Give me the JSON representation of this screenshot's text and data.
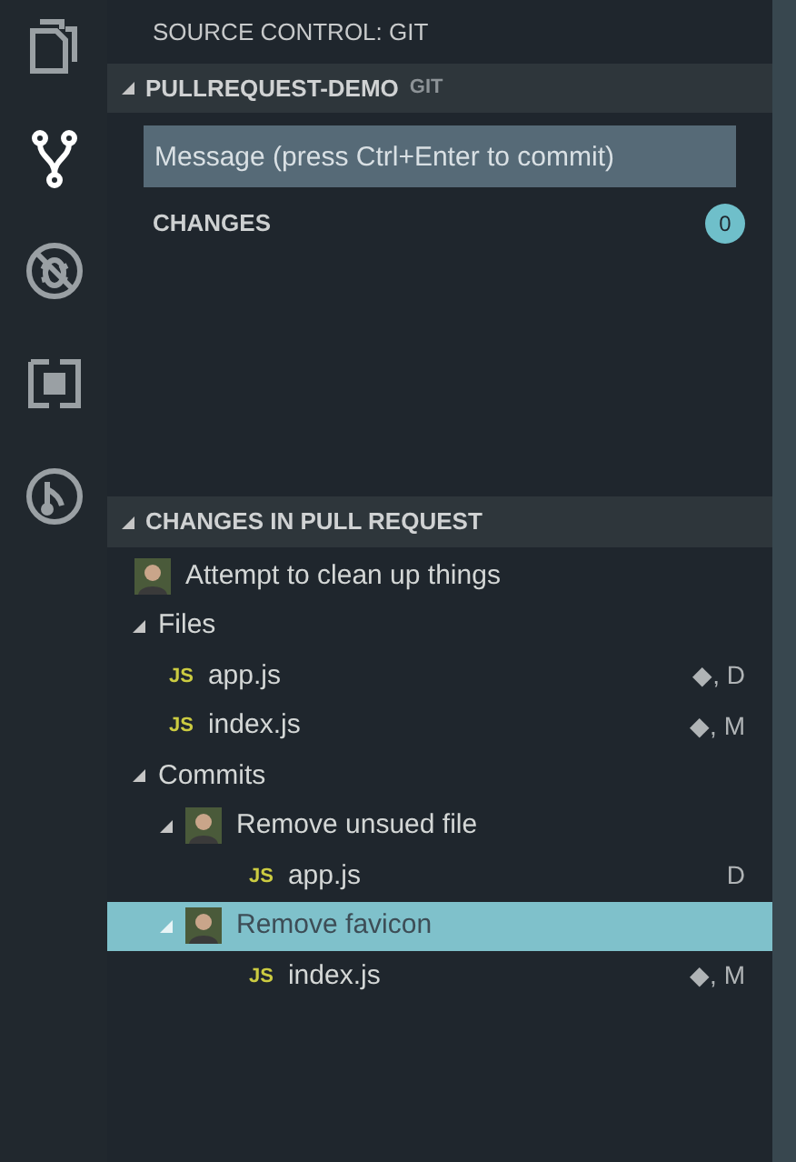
{
  "activity_bar": [
    {
      "kind": "files",
      "selected": false
    },
    {
      "kind": "scm",
      "selected": true
    },
    {
      "kind": "debug",
      "selected": false
    },
    {
      "kind": "extensions",
      "selected": false
    },
    {
      "kind": "pullrequest",
      "selected": false
    }
  ],
  "panel_title": "SOURCE CONTROL: GIT",
  "repo": {
    "name": "PULLREQUEST-DEMO",
    "provider": "GIT",
    "expanded": true
  },
  "message": {
    "placeholder": "Message (press Ctrl+Enter to commit)"
  },
  "changes": {
    "label": "CHANGES",
    "count": "0"
  },
  "pull_request": {
    "title": "CHANGES IN PULL REQUEST",
    "expanded": true,
    "tree": [
      {
        "kind": "commit",
        "label": "Attempt to clean up things",
        "selected": false,
        "children": [
          {
            "kind": "folder",
            "label": "Files",
            "expanded": true,
            "selected": false,
            "children": [
              {
                "kind": "file",
                "badge": "JS",
                "label": "app.js",
                "status": "◆, D",
                "selected": false
              },
              {
                "kind": "file",
                "badge": "JS",
                "label": "index.js",
                "status": "◆, M",
                "selected": false
              }
            ]
          },
          {
            "kind": "folder",
            "label": "Commits",
            "expanded": true,
            "selected": false,
            "children": [
              {
                "kind": "commit",
                "label": "Remove unsued file",
                "expanded": true,
                "selected": false,
                "children": [
                  {
                    "kind": "file",
                    "badge": "JS",
                    "label": "app.js",
                    "status": "D",
                    "selected": false
                  }
                ]
              },
              {
                "kind": "commit",
                "label": "Remove favicon",
                "expanded": true,
                "selected": true,
                "children": [
                  {
                    "kind": "file",
                    "badge": "JS",
                    "label": "index.js",
                    "status": "◆, M",
                    "selected": false
                  }
                ]
              }
            ]
          }
        ]
      }
    ]
  }
}
